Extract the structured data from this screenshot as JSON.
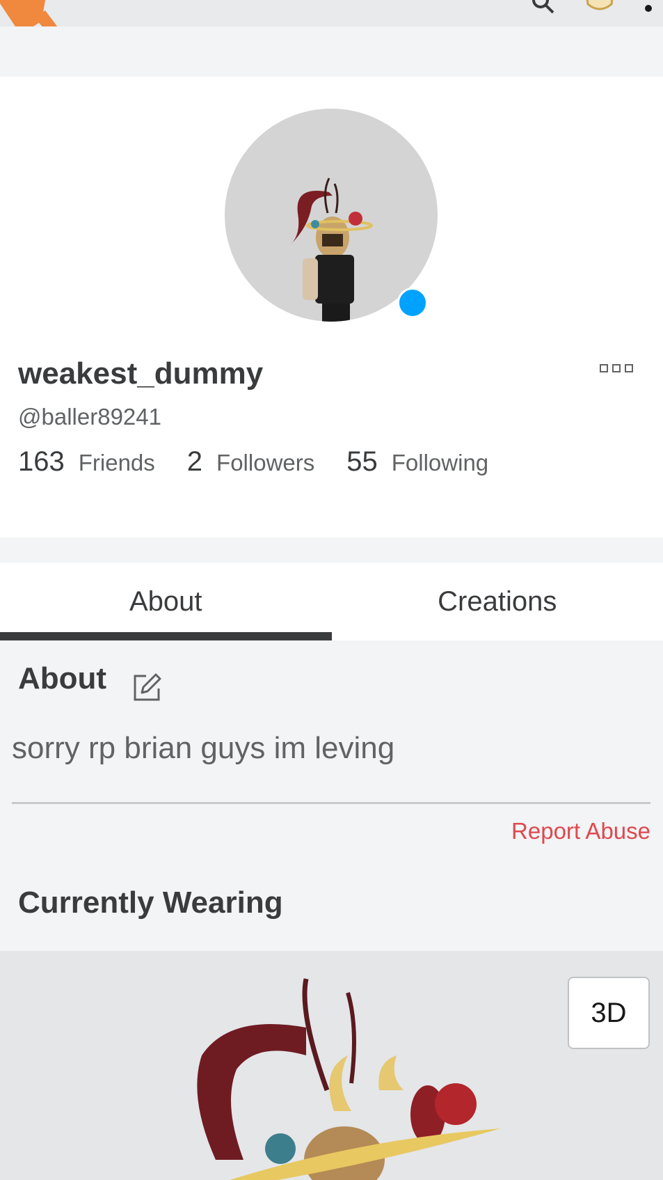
{
  "profile": {
    "display_name": "weakest_dummy",
    "username": "@baller89241",
    "online": true,
    "stats": [
      {
        "count": "163",
        "label": "Friends"
      },
      {
        "count": "2",
        "label": "Followers"
      },
      {
        "count": "55",
        "label": "Following"
      }
    ]
  },
  "tabs": [
    {
      "label": "About",
      "active": true
    },
    {
      "label": "Creations",
      "active": false
    }
  ],
  "about": {
    "heading": "About",
    "text": "sorry rp brian guys im leving",
    "report_label": "Report Abuse"
  },
  "wearing": {
    "heading": "Currently Wearing",
    "toggle_label": "3D"
  },
  "colors": {
    "accent_presence": "#00a2ff",
    "report": "#e0484f",
    "logo_orange": "#f0883e"
  },
  "icons": [
    "roblox-logo-icon",
    "search-icon",
    "shield-icon",
    "more-vertical-icon",
    "more-horizontal-icon",
    "edit-icon"
  ]
}
